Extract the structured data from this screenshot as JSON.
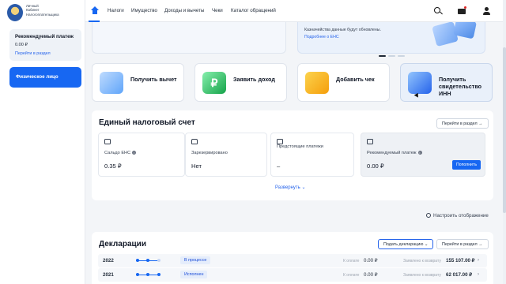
{
  "sidebar": {
    "logo_text": [
      "Личный",
      "Кабинет",
      "Налогоплательщика"
    ],
    "recommended": {
      "title": "Рекомендуемый платеж",
      "value": "0.00 ₽",
      "link": "Перейти в раздел"
    },
    "person_button": "Физическое лицо"
  },
  "nav": {
    "items": [
      "Налоги",
      "Имущество",
      "Доходы и вычеты",
      "Чеки",
      "Каталог обращений"
    ],
    "icons": [
      "home-icon",
      "search-icon",
      "mail-icon",
      "user-icon"
    ]
  },
  "banner": {
    "text": "Казначейства данные будут обновлены.",
    "link": "Подробнее о ЕНС"
  },
  "tiles": [
    {
      "label": "Получить вычет",
      "icon": "wallet-icon"
    },
    {
      "label": "Заявить доход",
      "icon": "ruble-icon"
    },
    {
      "label": "Добавить чек",
      "icon": "receipt-icon"
    },
    {
      "label": "Получить свидетельство ИНН",
      "icon": "id-card-icon"
    }
  ],
  "ens": {
    "title": "Единый налоговый счет",
    "goto": "Перейти в раздел →",
    "cards": [
      {
        "label": "Сальдо ЕНС",
        "value": "0.35 ₽",
        "icon": "wallet-icon"
      },
      {
        "label": "Зарезервировано",
        "value": "Нет",
        "icon": "lock-icon"
      },
      {
        "label": "Предстоящие платежи",
        "value": "–",
        "icon": "calendar-icon"
      },
      {
        "label": "Рекомендуемый платеж",
        "value": "0.00 ₽",
        "icon": "payment-icon"
      }
    ],
    "pay_button": "Пополнить",
    "expand": "Развернуть"
  },
  "settings_label": "Настроить отображение",
  "declarations": {
    "title": "Декларации",
    "submit": "Подать декларацию",
    "goto": "Перейти в раздел →",
    "pay_label": "К оплате",
    "refund_label": "Заявлено к возврату",
    "rows": [
      {
        "year": "2022",
        "status": "В процессе",
        "pay": "0.00 ₽",
        "refund": "155 107.00 ₽"
      },
      {
        "year": "2021",
        "status": "Исполнен",
        "pay": "0.00 ₽",
        "refund": "62 017.00 ₽"
      }
    ]
  },
  "colors": {
    "accent": "#1767f2",
    "background": "#f3f5f8"
  }
}
